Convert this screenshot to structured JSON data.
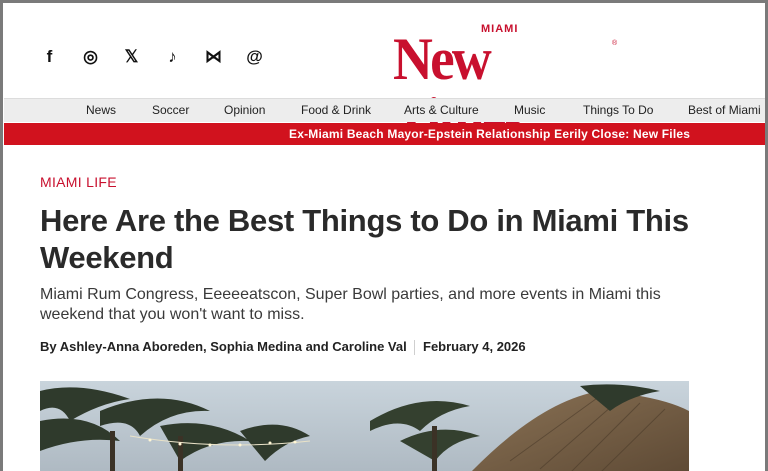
{
  "social": [
    {
      "icon": "facebook-icon",
      "glyph": "f"
    },
    {
      "icon": "instagram-icon",
      "glyph": "◎"
    },
    {
      "icon": "x-icon",
      "glyph": "𝕏"
    },
    {
      "icon": "tiktok-icon",
      "glyph": "♪"
    },
    {
      "icon": "bluesky-icon",
      "glyph": "⋈"
    },
    {
      "icon": "threads-icon",
      "glyph": "@"
    }
  ],
  "logo": {
    "small": "MIAMI",
    "big": "New Times",
    "reg": "®"
  },
  "nav": [
    "News",
    "Soccer",
    "Opinion",
    "Food & Drink",
    "Arts & Culture",
    "Music",
    "Things To Do",
    "Best of Miami"
  ],
  "ticker": "Ex-Miami Beach Mayor-Epstein Relationship Eerily Close: New Files",
  "article": {
    "section": "MIAMI LIFE",
    "headline": "Here Are the Best Things to Do in Miami This Weekend",
    "dek": "Miami Rum Congress, Eeeeeatscon, Super Bowl parties, and more events in Miami this weekend that you won't want to miss.",
    "byline": "By Ashley-Anna Aboreden, Sophia Medina and Caroline Val",
    "date": "February 4, 2026"
  }
}
